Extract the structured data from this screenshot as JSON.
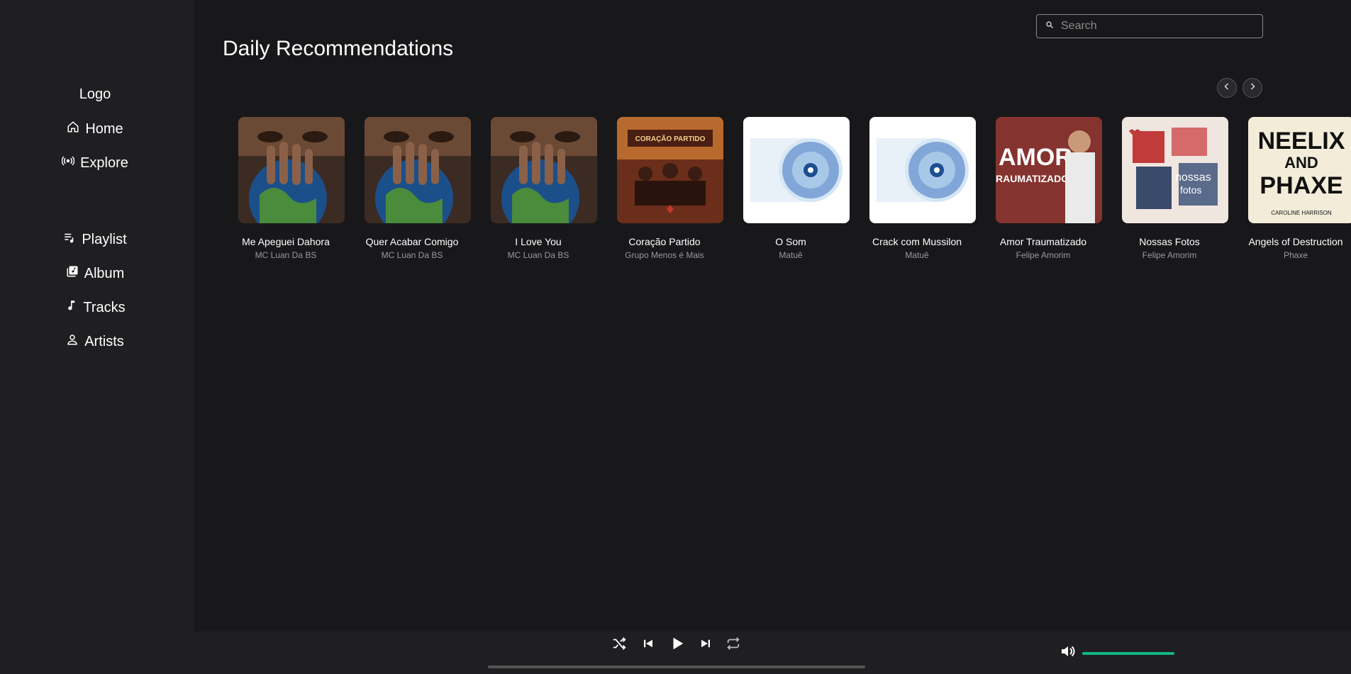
{
  "sidebar": {
    "logo": "Logo",
    "items": [
      {
        "label": "Home",
        "icon": "home-icon"
      },
      {
        "label": "Explore",
        "icon": "broadcast-icon"
      },
      {
        "label": "Playlist",
        "icon": "playlist-icon"
      },
      {
        "label": "Album",
        "icon": "album-icon"
      },
      {
        "label": "Tracks",
        "icon": "music-note-icon"
      },
      {
        "label": "Artists",
        "icon": "user-icon"
      }
    ]
  },
  "search": {
    "placeholder": "Search",
    "value": ""
  },
  "main": {
    "title": "Daily Recommendations",
    "cards": [
      {
        "title": "Me Apeguei Dahora",
        "artist": "MC Luan Da BS",
        "cover": "world-mundo"
      },
      {
        "title": "Quer Acabar Comigo",
        "artist": "MC Luan Da BS",
        "cover": "world-mundo"
      },
      {
        "title": "I Love You",
        "artist": "MC Luan Da BS",
        "cover": "world-mundo"
      },
      {
        "title": "Coração Partido",
        "artist": "Grupo Menos é Mais",
        "cover": "coracao-partido"
      },
      {
        "title": "O Som",
        "artist": "Matuê",
        "cover": "disc"
      },
      {
        "title": "Crack com Mussilon",
        "artist": "Matuê",
        "cover": "disc"
      },
      {
        "title": "Amor Traumatizado",
        "artist": "Felipe Amorim",
        "cover": "amor"
      },
      {
        "title": "Nossas Fotos",
        "artist": "Felipe Amorim",
        "cover": "nossas-fotos"
      },
      {
        "title": "Angels of Destruction",
        "artist": "Phaxe",
        "cover": "neelix-phaxe"
      }
    ],
    "cover_text": {
      "coracao": "CORAÇÃO PARTIDO",
      "amor": "AMOR",
      "traumatizado": "RAUMATIZADO",
      "nossas": "nossas",
      "fotos": "fotos",
      "neelix": "NEELIX",
      "and": "AND",
      "phaxe": "PHAXE",
      "caroline": "CAROLINE HARRISON"
    }
  },
  "player": {
    "progress": 0,
    "volume": 1.0,
    "accent": "#10b981"
  }
}
